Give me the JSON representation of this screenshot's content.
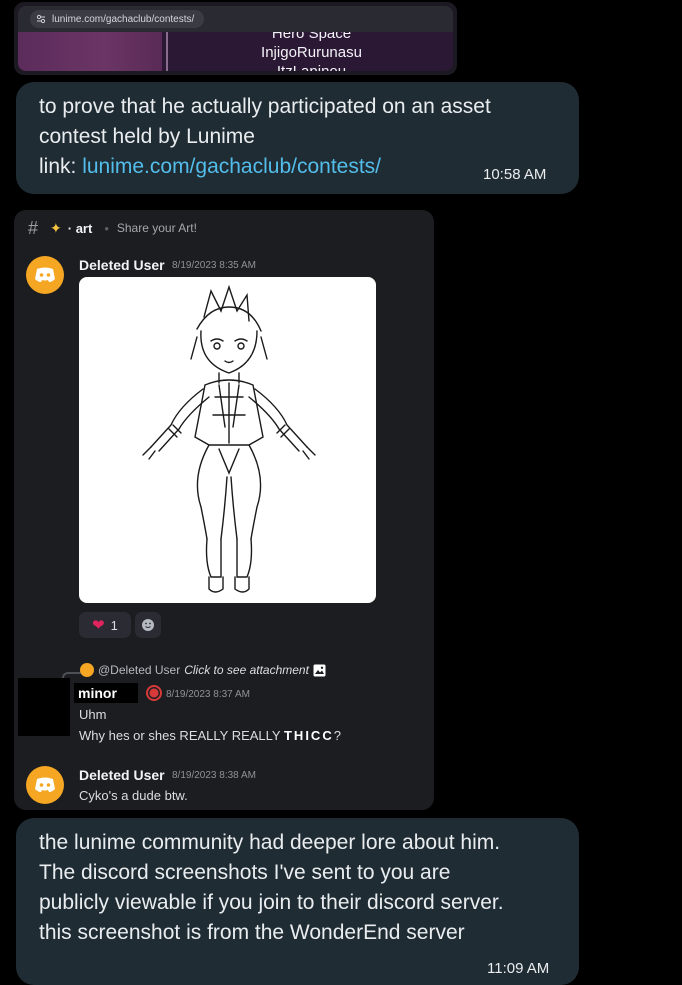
{
  "browser_card": {
    "url": "lunime.com/gachaclub/contests/",
    "names": [
      "Hero Space",
      "InjigoRurunasu",
      "ItzLapinou"
    ]
  },
  "bubble1": {
    "line1": "to prove that he actually participated on an asset",
    "line2": "contest held by Lunime",
    "link_prefix": "link: ",
    "link": "lunime.com/gachaclub/contests/",
    "time": "10:58 AM"
  },
  "discord": {
    "channel": "· art",
    "topic": "Share your Art!",
    "msg1": {
      "author": "Deleted User",
      "timestamp": "8/19/2023 8:35 AM"
    },
    "reaction": {
      "emoji": "❤",
      "count": "1"
    },
    "reply": {
      "reference_user": "@Deleted User",
      "reference_text": "Click to see attachment",
      "author": "minor",
      "timestamp": "8/19/2023 8:37 AM",
      "line1": "Uhm",
      "line2_prefix": "Why hes or shes REALLY REALLY ",
      "line2_emph": "THICC",
      "line2_suffix": "?"
    },
    "msg3": {
      "author": "Deleted User",
      "timestamp": "8/19/2023 8:38 AM",
      "text": "Cyko's a dude btw."
    }
  },
  "bubble2": {
    "line1": "the lunime community had deeper lore about him.",
    "line2": "The discord screenshots I've sent to you are",
    "line3": "publicly viewable if you join to their discord server.",
    "line4": "this screenshot is from the WonderEnd server",
    "time": "11:09 AM"
  },
  "colors": {
    "chat_bg": "#000000",
    "bubble_bg": "#202c33",
    "link": "#53bdeb",
    "discord_bg": "#1c1d21",
    "avatar": "#f5a623"
  }
}
